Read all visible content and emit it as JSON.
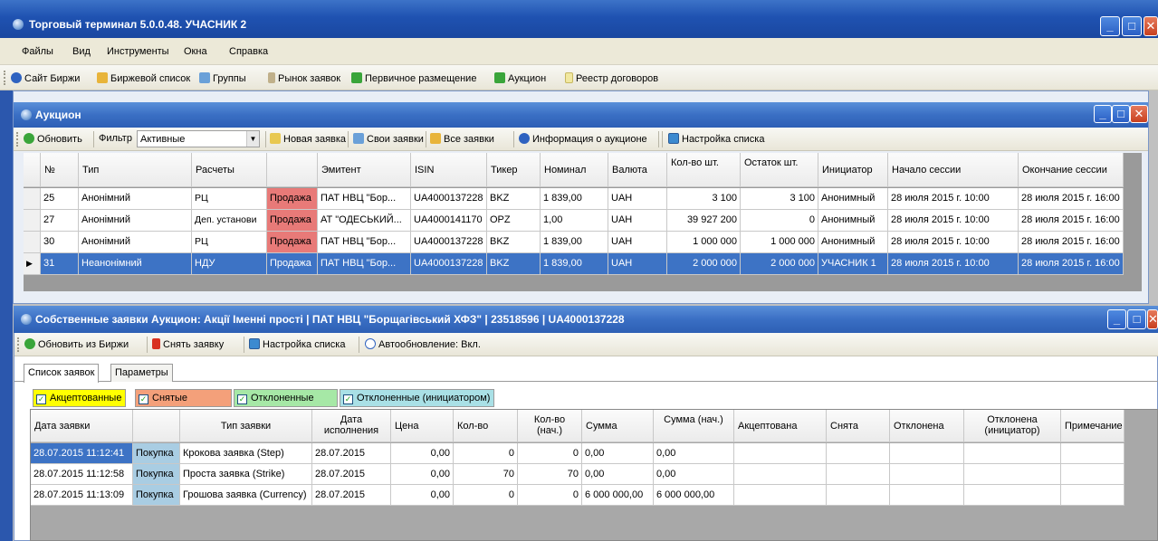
{
  "app": {
    "title": "Торговый терминал 5.0.0.48. УЧАСНИК 2",
    "window_buttons": [
      "minimize-icon",
      "maximize-icon",
      "close-icon"
    ]
  },
  "menu": [
    "Файлы",
    "Вид",
    "Инструменты",
    "Окна",
    "Справка"
  ],
  "main_toolbar": [
    {
      "label": "Сайт Биржи",
      "icon": "globe-icon"
    },
    {
      "label": "Биржевой список",
      "icon": "folder-icon"
    },
    {
      "label": "Группы",
      "icon": "tree-icon"
    },
    {
      "label": "Рынок заявок",
      "icon": "pin-icon"
    },
    {
      "label": "Первичное размещение",
      "icon": "handshake-icon"
    },
    {
      "label": "Аукцион",
      "icon": "handshake-icon"
    },
    {
      "label": "Реестр договоров",
      "icon": "document-icon"
    }
  ],
  "auction": {
    "title": "Аукцион",
    "toolbar": {
      "refresh": "Обновить",
      "filter_label": "Фильтр",
      "filter_value": "Активные",
      "new_order": "Новая заявка",
      "own_orders": "Свои заявки",
      "all_orders": "Все заявки",
      "auction_info": "Информация о аукционе",
      "list_settings": "Настройка списка"
    },
    "columns": [
      "№",
      "Тип",
      "Расчеты",
      "",
      "Эмитент",
      "ISIN",
      "Тикер",
      "Номинал",
      "Валюта",
      "Кол-во шт.",
      "Остаток шт.",
      "Инициатор",
      "Начало сессии",
      "Окончание сессии"
    ],
    "rows": [
      [
        "25",
        "Анонімний",
        "РЦ",
        "Продажа",
        "ПАТ НВЦ \"Бор...",
        "UA4000137228",
        "BKZ",
        "1 839,00",
        "UAH",
        "3 100",
        "3 100",
        "Анонимный",
        "28 июля 2015 г. 10:00",
        "28 июля 2015 г. 16:00"
      ],
      [
        "27",
        "Анонімний",
        "Деп. установи",
        "Продажа",
        "АТ \"ОДЕСЬКИЙ...",
        "UA4000141170",
        "OPZ",
        "1,00",
        "UAH",
        "39 927 200",
        "0",
        "Анонимный",
        "28 июля 2015 г. 10:00",
        "28 июля 2015 г. 16:00"
      ],
      [
        "30",
        "Анонімний",
        "РЦ",
        "Продажа",
        "ПАТ НВЦ \"Бор...",
        "UA4000137228",
        "BKZ",
        "1 839,00",
        "UAH",
        "1 000 000",
        "1 000 000",
        "Анонимный",
        "28 июля 2015 г. 10:00",
        "28 июля 2015 г. 16:00"
      ],
      [
        "31",
        "Неанонімний",
        "НДУ",
        "Продажа",
        "ПАТ НВЦ \"Бор...",
        "UA4000137228",
        "BKZ",
        "1 839,00",
        "UAH",
        "2 000 000",
        "2 000 000",
        "УЧАСНИК 1",
        "28 июля 2015 г. 10:00",
        "28 июля 2015 г. 16:00"
      ]
    ]
  },
  "own_orders": {
    "title": "Собственные заявки Аукцион: Акції Іменні прості | ПАТ НВЦ \"Борщагівський ХФЗ\" | 23518596 | UA4000137228",
    "toolbar": {
      "refresh": "Обновить из Биржи",
      "cancel": "Снять заявку",
      "list_settings": "Настройка списка",
      "autoupdate": "Автообновление: Вкл."
    },
    "tabs": [
      "Список заявок",
      "Параметры"
    ],
    "filters": [
      {
        "label": "Акцептованные",
        "color": "#ffff00"
      },
      {
        "label": "Снятые",
        "color": "#f4a07a"
      },
      {
        "label": "Отклоненные",
        "color": "#a6e8a6"
      },
      {
        "label": "Отклоненные (инициатором)",
        "color": "#a9e0e6"
      }
    ],
    "columns": [
      "Дата заявки",
      "",
      "Тип заявки",
      "Дата исполнения",
      "Цена",
      "Кол-во",
      "Кол-во (нач.)",
      "Сумма",
      "Сумма (нач.)",
      "Акцептована",
      "Снята",
      "Отклонена",
      "Отклонена (инициатор)",
      "Примечание"
    ],
    "rows": [
      [
        "28.07.2015 11:12:41",
        "Покупка",
        "Крокова заявка (Step)",
        "28.07.2015",
        "0,00",
        "0",
        "0",
        "0,00",
        "0,00",
        "",
        "",
        "",
        "",
        ""
      ],
      [
        "28.07.2015 11:12:58",
        "Покупка",
        "Проста заявка (Strike)",
        "28.07.2015",
        "0,00",
        "70",
        "70",
        "0,00",
        "0,00",
        "",
        "",
        "",
        "",
        ""
      ],
      [
        "28.07.2015 11:13:09",
        "Покупка",
        "Грошова заявка (Currency)",
        "28.07.2015",
        "0,00",
        "0",
        "0",
        "6 000 000,00",
        "6 000 000,00",
        "",
        "",
        "",
        "",
        ""
      ]
    ]
  },
  "colors": {
    "titlebar": "#1f52b1",
    "selected_row": "#3d73c5",
    "sale": "#e87a78",
    "buy": "#a9cde3"
  }
}
